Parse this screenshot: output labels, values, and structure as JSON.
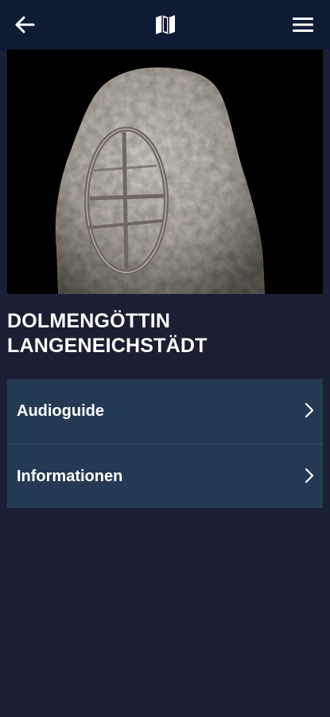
{
  "topbar": {
    "back_icon": "arrow-left-icon",
    "map_icon": "map-icon",
    "menu_icon": "hamburger-menu-icon"
  },
  "hero": {
    "image": "carved-stone-goddess-photo"
  },
  "title": {
    "line1": "DOLMENGÖTTIN",
    "line2": "LANGENEICHSTÄDT"
  },
  "menu": {
    "items": [
      {
        "label": "Audioguide",
        "icon": "chevron-right-icon"
      },
      {
        "label": "Informationen",
        "icon": "chevron-right-icon"
      }
    ]
  },
  "colors": {
    "background": "#1a1f33",
    "topbar": "#0f1a33",
    "list_item": "#233a52",
    "text": "#ffffff"
  }
}
